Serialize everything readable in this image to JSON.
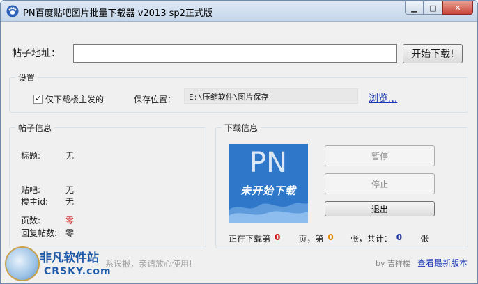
{
  "window": {
    "title": "PN百度贴吧图片批量下载器 v2013 sp2正式版",
    "controls": [
      "minimize",
      "maximize",
      "close"
    ]
  },
  "url_bar": {
    "label": "帖子地址：",
    "value": "",
    "start_button": "开始下载!"
  },
  "settings": {
    "title": "设置",
    "only_op_label": "仅下载楼主发的",
    "only_op_checked": true,
    "save_label": "保存位置：",
    "save_path": "E:\\压缩软件\\图片保存",
    "browse_label": "浏览..."
  },
  "post_info": {
    "title": "帖子信息",
    "rows": [
      {
        "key": "标题:",
        "value": "无"
      },
      {
        "key": "贴吧:",
        "value": "无"
      },
      {
        "key": "楼主id:",
        "value": "无"
      },
      {
        "key": "页数:",
        "value": "零"
      },
      {
        "key": "回复帖数:",
        "value": "零"
      }
    ]
  },
  "download_info": {
    "title": "下载信息",
    "logo_text": "PN",
    "logo_subtext": "未开始下载",
    "pause_button": "暂停",
    "stop_button": "停止",
    "exit_button": "退出",
    "status": {
      "prefix": "正在下载第",
      "page_num": "0",
      "page_sep": "页，第",
      "post_num": "0",
      "total_sep": "张，共计：",
      "total_num": "0",
      "suffix": "张"
    }
  },
  "footer": {
    "note": "系误报，亲请放心使用!",
    "by": "by 吉祥楼",
    "link": "查看最新版本"
  },
  "watermark": {
    "title": "非凡软件站",
    "subtitle": "CRSKY.com"
  },
  "colors": {
    "accent_link": "#1a37b8",
    "logo_bg": "#2f77c9",
    "red_value": "#d01818",
    "orange_value": "#e08a00",
    "blue_value": "#1a2f9c"
  }
}
